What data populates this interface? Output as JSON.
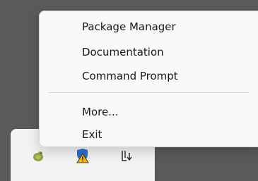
{
  "context_menu": {
    "items": [
      {
        "label": "Package Manager"
      },
      {
        "label": "Documentation"
      },
      {
        "label": "Command Prompt"
      }
    ],
    "secondary_items": [
      {
        "label": "More..."
      },
      {
        "label": "Exit"
      }
    ]
  },
  "tray": {
    "icons": [
      {
        "name": "python-snake-icon",
        "color": "#8aa64a"
      },
      {
        "name": "security-warning-icon",
        "color": "#2b6fd1"
      },
      {
        "name": "usb-device-icon",
        "color": "#222222"
      }
    ]
  },
  "colors": {
    "desktop": "#5a5a5a",
    "menu_background": "#f9f9f9",
    "tray_background": "#f3f3f3",
    "warning_yellow": "#ffb900"
  }
}
